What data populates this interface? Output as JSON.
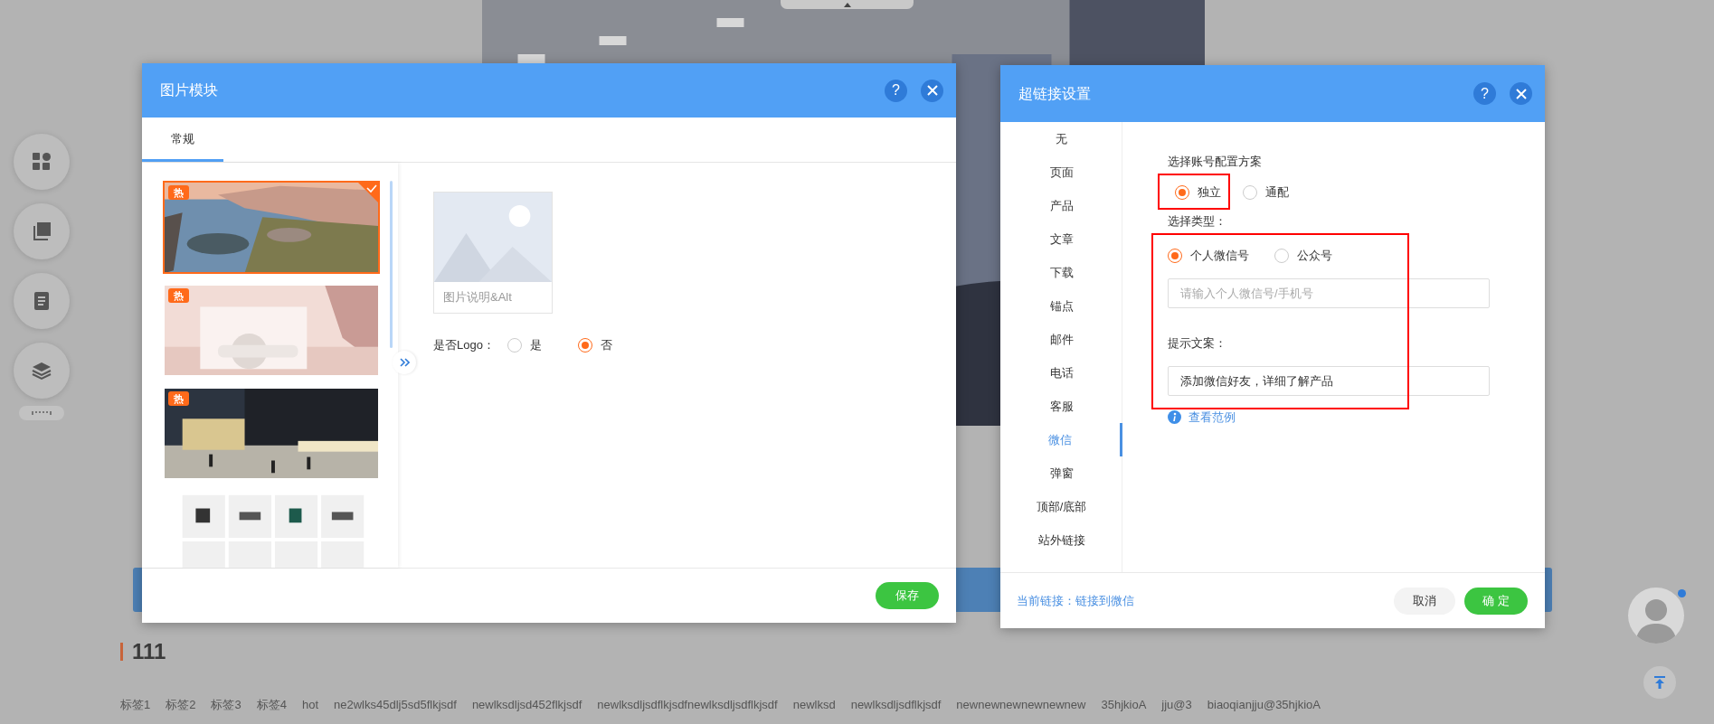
{
  "page": {
    "heading": "111",
    "tags": [
      "标签1",
      "标签2",
      "标签3",
      "标签4",
      "hot",
      "ne2wlks45dlj5sd5flkjsdf",
      "newlksdljsd452flkjsdf",
      "newlksdljsdflkjsdfnewlksdljsdflkjsdf",
      "newlksd",
      "newlksdljsdflkjsdf",
      "newnewnewnewnewnew",
      "35hjkioA",
      "jju@3",
      "biaoqianjju@35hjkioA"
    ]
  },
  "image_dialog": {
    "title": "图片模块",
    "help": "?",
    "tabs": [
      {
        "label": "常规",
        "selected": true
      }
    ],
    "thumbnails": [
      {
        "badge": "热",
        "selected": true
      },
      {
        "badge": "热",
        "selected": false
      },
      {
        "badge": "热",
        "selected": false
      },
      {
        "selected": false
      }
    ],
    "caption": "图片说明&Alt",
    "logo_label": "是否Logo：",
    "logo_options": [
      {
        "label": "是",
        "selected": false
      },
      {
        "label": "否",
        "selected": true
      }
    ],
    "save_button": "保存"
  },
  "link_dialog": {
    "title": "超链接设置",
    "help": "?",
    "nav": [
      {
        "label": "无",
        "selected": false
      },
      {
        "label": "页面",
        "selected": false
      },
      {
        "label": "产品",
        "selected": false
      },
      {
        "label": "文章",
        "selected": false
      },
      {
        "label": "下载",
        "selected": false
      },
      {
        "label": "锚点",
        "selected": false
      },
      {
        "label": "邮件",
        "selected": false
      },
      {
        "label": "电话",
        "selected": false
      },
      {
        "label": "客服",
        "selected": false
      },
      {
        "label": "微信",
        "selected": true
      },
      {
        "label": "弹窗",
        "selected": false
      },
      {
        "label": "顶部/底部",
        "selected": false
      },
      {
        "label": "站外链接",
        "selected": false
      }
    ],
    "scheme_label": "选择账号配置方案",
    "scheme_options": [
      {
        "label": "独立",
        "selected": true
      },
      {
        "label": "通配",
        "selected": false
      }
    ],
    "type_label": "选择类型：",
    "type_options": [
      {
        "label": "个人微信号",
        "selected": true
      },
      {
        "label": "公众号",
        "selected": false
      }
    ],
    "account_input": {
      "placeholder": "请输入个人微信号/手机号"
    },
    "hint_label": "提示文案：",
    "hint_input": {
      "value": "添加微信好友，详细了解产品"
    },
    "example_link": "查看范例",
    "current_link": "当前链接：链接到微信",
    "cancel_button": "取消",
    "confirm_button": "确 定"
  }
}
